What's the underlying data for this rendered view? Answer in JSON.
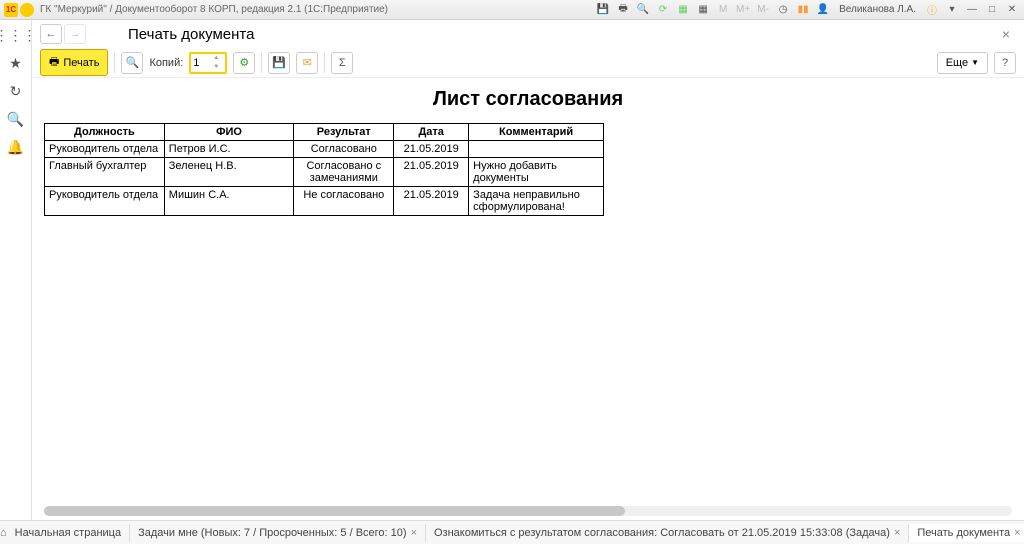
{
  "titlebar": {
    "logo_text": "1C",
    "title": "ГК \"Меркурий\" / Документооборот 8 КОРП, редакция 2.1  (1С:Предприятие)",
    "user": "Великанова Л.А."
  },
  "header": {
    "page_title": "Печать документа"
  },
  "toolbar": {
    "print_label": "Печать",
    "copies_label": "Копий:",
    "copies_value": "1",
    "more_label": "Еще",
    "help_label": "?"
  },
  "document": {
    "title": "Лист согласования",
    "columns": {
      "position": "Должность",
      "fio": "ФИО",
      "result": "Результат",
      "date": "Дата",
      "comment": "Комментарий"
    },
    "rows": [
      {
        "position": "Руководитель отдела",
        "fio": "Петров И.С.",
        "result": "Согласовано",
        "date": "21.05.2019",
        "comment": ""
      },
      {
        "position": "Главный бухгалтер",
        "fio": "Зеленец Н.В.",
        "result": "Согласовано с замечаниями",
        "date": "21.05.2019",
        "comment": "Нужно добавить документы"
      },
      {
        "position": "Руководитель отдела",
        "fio": "Мишин С.А.",
        "result": "Не согласовано",
        "date": "21.05.2019",
        "comment": "Задача неправильно сформулирована!"
      }
    ]
  },
  "taskbar": {
    "home": "Начальная страница",
    "tabs": [
      "Задачи мне (Новых: 7 / Просроченных: 5 / Всего: 10)",
      "Ознакомиться с результатом согласования: Согласовать от 21.05.2019 15:33:08 (Задача)",
      "Печать документа"
    ]
  }
}
